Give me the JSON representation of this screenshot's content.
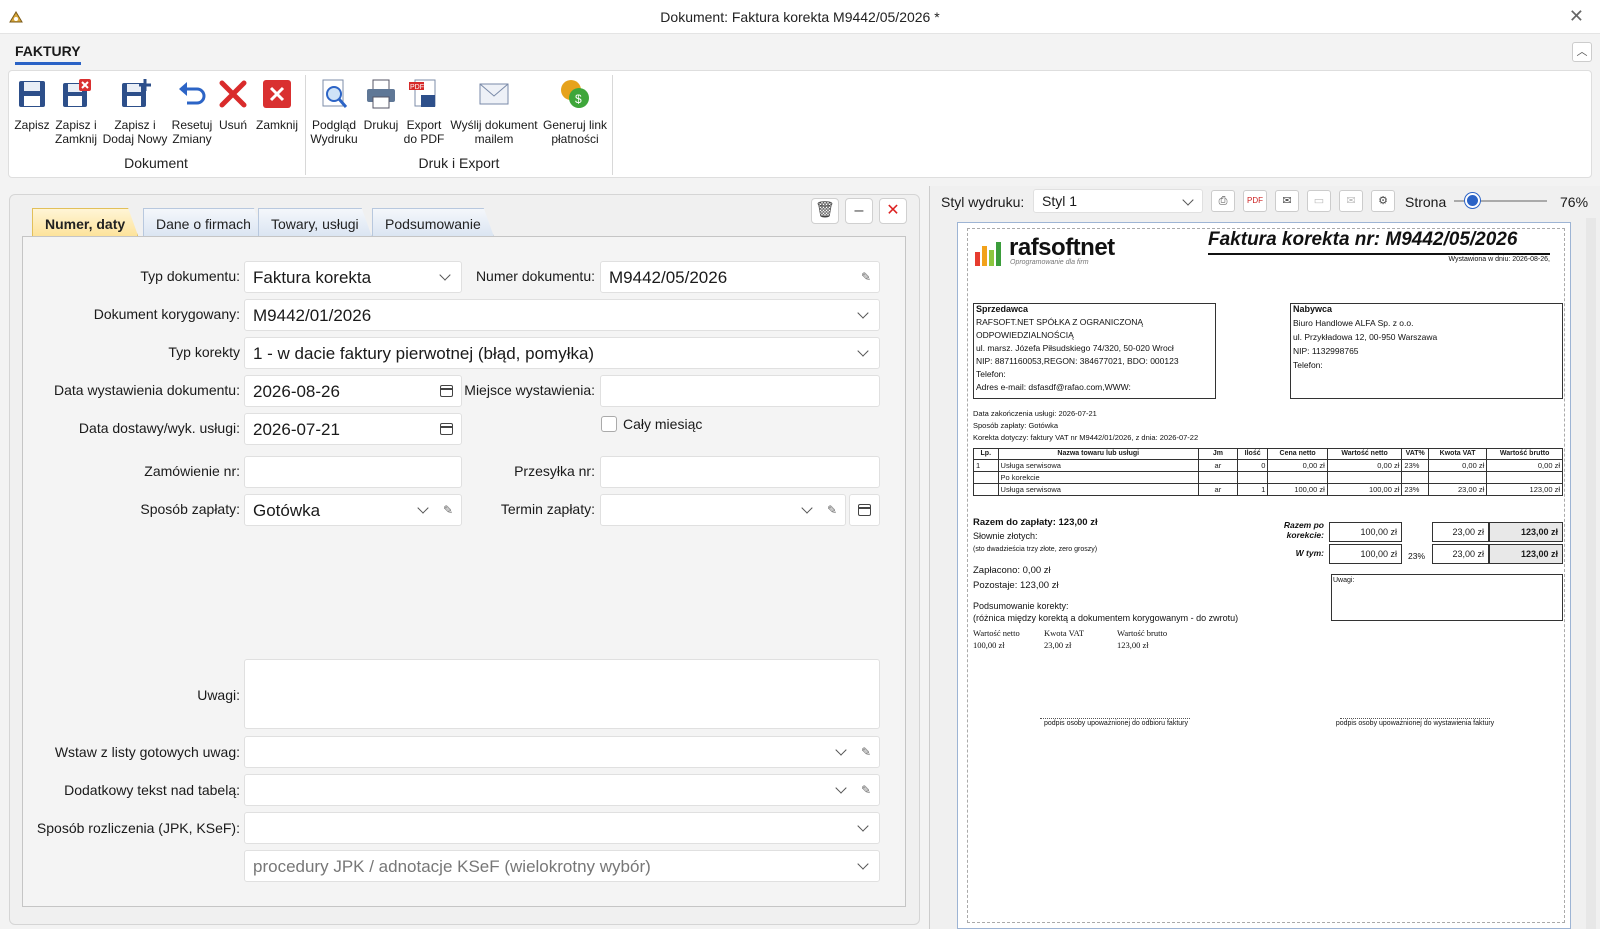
{
  "window": {
    "title": "Dokument: Faktura korekta M9442/05/2026 *"
  },
  "ribbon": {
    "tab": "FAKTURY",
    "buttons": [
      {
        "label1": "Zapisz",
        "label2": ""
      },
      {
        "label1": "Zapisz i",
        "label2": "Zamknij"
      },
      {
        "label1": "Zapisz i",
        "label2": "Dodaj Nowy"
      },
      {
        "label1": "Resetuj",
        "label2": "Zmiany"
      },
      {
        "label1": "Usuń",
        "label2": ""
      },
      {
        "label1": "Zamknij",
        "label2": ""
      },
      {
        "label1": "Podgląd",
        "label2": "Wydruku"
      },
      {
        "label1": "Drukuj",
        "label2": ""
      },
      {
        "label1": "Export",
        "label2": "do PDF"
      },
      {
        "label1": "Wyślij dokument",
        "label2": "mailem"
      },
      {
        "label1": "Generuj link",
        "label2": "płatności"
      }
    ],
    "groups": {
      "doc": "Dokument",
      "print": "Druk i Export"
    }
  },
  "tabs": [
    "Numer, daty",
    "Dane o firmach",
    "Towary, usługi",
    "Podsumowanie"
  ],
  "form": {
    "typ_dok_label": "Typ dokumentu:",
    "typ_dok": "Faktura korekta",
    "numer_label": "Numer dokumentu:",
    "numer": "M9442/05/2026",
    "korygowany_label": "Dokument korygowany:",
    "korygowany": "M9442/01/2026",
    "typ_korekty_label": "Typ korekty",
    "typ_korekty": "1 - w dacie faktury pierwotnej (błąd, pomyłka)",
    "data_wyst_label": "Data wystawienia dokumentu:",
    "data_wyst": "2026-08-26",
    "miejsce_label": "Miejsce wystawienia:",
    "miejsce": "",
    "data_dost_label": "Data dostawy/wyk. usługi:",
    "data_dost": "2026-07-21",
    "caly_miesiac": "Cały miesiąc",
    "zamowienie_label": "Zamówienie nr:",
    "zamowienie": "",
    "przesylka_label": "Przesyłka nr:",
    "przesylka": "",
    "sposob_zap_label": "Sposób zapłaty:",
    "sposob_zap": "Gotówka",
    "termin_label": "Termin zapłaty:",
    "termin": "",
    "uwagi_label": "Uwagi:",
    "uwagi": "",
    "wstaw_label": "Wstaw z listy gotowych uwag:",
    "dodatkowy_label": "Dodatkowy tekst nad tabelą:",
    "rozliczenie_label": "Sposób rozliczenia (JPK, KSeF):",
    "procedury_placeholder": "procedury JPK / adnotacje KSeF (wielokrotny wybór)"
  },
  "preview": {
    "styl_label": "Styl wydruku:",
    "styl": "Styl 1",
    "strona_label": "Strona",
    "zoom": "76%",
    "logo": "rafsoftnet",
    "logo_sub": "Oprogramowanie dla firm",
    "doc_title": "Faktura korekta nr: M9442/05/2026",
    "wystawiona": "Wystawiona w dniu: 2026-08-26,",
    "seller_title": "Sprzedawca",
    "seller_lines": [
      "RAFSOFT.NET SPÓŁKA Z OGRANICZONĄ",
      "ODPOWIEDZIALNOŚCIĄ",
      "ul. marsz. Józefa Piłsudskiego 74/320, 50-020 Wrocł",
      "NIP: 8871160053,REGON: 384677021, BDO: 000123",
      "Telefon:",
      "Adres e-mail: dsfasdf@rafao.com,WWW:"
    ],
    "buyer_title": "Nabywca",
    "buyer_lines": [
      "Biuro Handlowe ALFA Sp. z o.o.",
      "ul. Przykładowa 12, 00-950 Warszawa",
      "NIP: 1132998765",
      "Telefon:"
    ],
    "info_lines": [
      "Data zakończenia usługi: 2026-07-21",
      "Sposób zapłaty: Gotówka",
      "Korekta dotyczy: faktury VAT nr M9442/01/2026, z dnia: 2026-07-22"
    ],
    "table_headers": [
      "Lp.",
      "Nazwa towaru lub usługi",
      "Jm",
      "Ilość",
      "Cena netto",
      "Wartość netto",
      "VAT%",
      "Kwota VAT",
      "Wartość brutto"
    ],
    "rows": [
      [
        "1",
        "Usługa serwisowa",
        "ar",
        "0",
        "0,00 zł",
        "0,00 zł",
        "23%",
        "0,00 zł",
        "0,00 zł"
      ],
      [
        "",
        "Po korekcie",
        "",
        "",
        "",
        "",
        "",
        "",
        ""
      ],
      [
        "",
        "Usługa serwisowa",
        "ar",
        "1",
        "100,00 zł",
        "100,00 zł",
        "23%",
        "23,00 zł",
        "123,00 zł"
      ]
    ],
    "razem": "Razem do zapłaty: 123,00 zł",
    "slownie": "Słownie złotych:",
    "slownie_val": "(sto dwadzieścia trzy złote, zero groszy)",
    "zaplacono": "Zapłacono: 0,00 zł",
    "pozostaje": "Pozostaje: 123,00 zł",
    "razem_po": "Razem po korekcie:",
    "w_tym": "W tym:",
    "sum1": [
      "100,00 zł",
      "23,00 zł",
      "123,00 zł"
    ],
    "sum2": [
      "100,00 zł",
      "23%",
      "23,00 zł",
      "123,00 zł"
    ],
    "uwagi_box": "Uwagi:",
    "podsumowanie": "Podsumowanie korekty:",
    "roznica": "(różnica między korektą a dokumentem korygowanym - do zwrotu)",
    "k_headers": [
      "Wartość netto",
      "Kwota VAT",
      "Wartość brutto"
    ],
    "k_values": [
      "100,00 zł",
      "23,00 zł",
      "123,00 zł"
    ],
    "podpis1": "podpis osoby upoważnionej do odbioru faktury",
    "podpis2": "podpis osoby upoważnionej do wystawienia faktury"
  }
}
